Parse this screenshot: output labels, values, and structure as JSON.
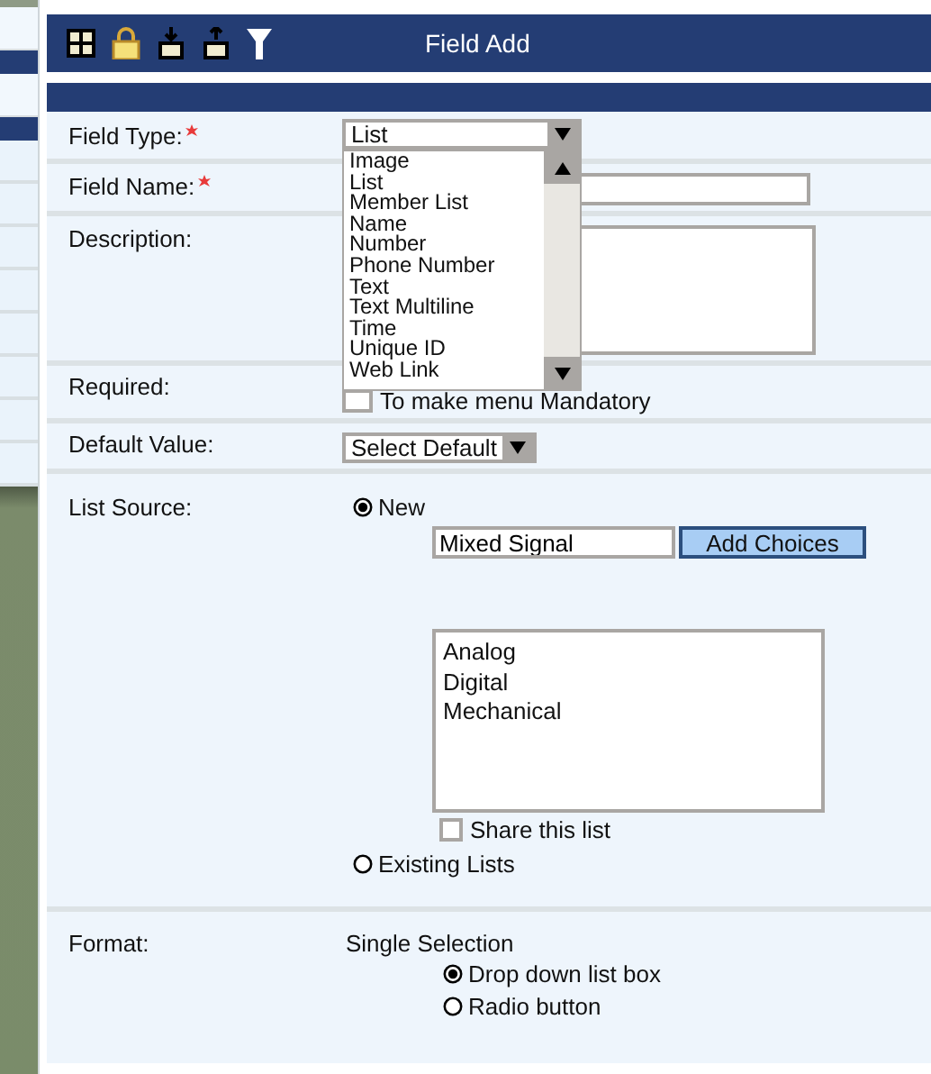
{
  "window": {
    "title": "Field Add"
  },
  "field_type": {
    "label": "Field Type:",
    "required": true,
    "value": "List",
    "options": [
      "Image",
      "List",
      "Member List",
      "Name",
      "Number",
      "Phone Number",
      "Text",
      "Text Multiline",
      "Time",
      "Unique ID",
      "Web Link"
    ]
  },
  "field_name": {
    "label": "Field Name:",
    "required": true
  },
  "description": {
    "label": "Description:"
  },
  "required": {
    "label": "Required:",
    "checkbox": {
      "label": "To make menu Mandatory",
      "checked": false
    }
  },
  "default_value": {
    "label": "Default Value:",
    "value": "Select Default"
  },
  "list_source": {
    "label": "List Source:",
    "options": [
      {
        "label": "New",
        "selected": true
      },
      {
        "label": "Existing Lists",
        "selected": false
      }
    ],
    "choice_input": "Mixed Signal",
    "add_button": "Add Choices",
    "choices": [
      "Analog",
      "Digital",
      "Mechanical"
    ],
    "share": {
      "label": "Share this list",
      "checked": false
    }
  },
  "format": {
    "label": "Format:",
    "heading": "Single Selection",
    "options": [
      {
        "label": "Drop down list box",
        "selected": true
      },
      {
        "label": "Radio button",
        "selected": false
      }
    ]
  }
}
